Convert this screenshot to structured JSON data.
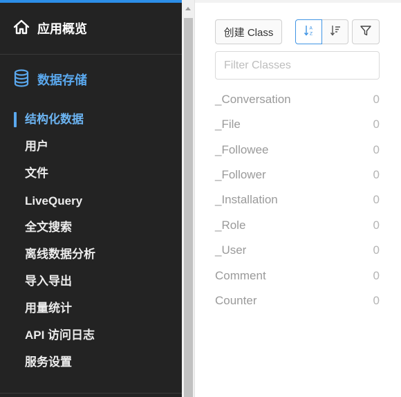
{
  "sidebar": {
    "overview_label": "应用概览",
    "storage_label": "数据存储",
    "items": [
      {
        "label": "结构化数据",
        "active": true
      },
      {
        "label": "用户"
      },
      {
        "label": "文件"
      },
      {
        "label": "LiveQuery"
      },
      {
        "label": "全文搜索"
      },
      {
        "label": "离线数据分析"
      },
      {
        "label": "导入导出"
      },
      {
        "label": "用量统计"
      },
      {
        "label": "API 访问日志"
      },
      {
        "label": "服务设置"
      }
    ],
    "accent_color": "#5aa8ee",
    "background_color": "#232323"
  },
  "toolbar": {
    "create_label": "创建 Class",
    "sort_alpha_icon": "sort-alpha-icon",
    "sort_desc_icon": "sort-desc-icon",
    "filter_icon": "filter-icon"
  },
  "search": {
    "placeholder": "Filter Classes",
    "value": ""
  },
  "classes": [
    {
      "name": "_Conversation",
      "count": "0"
    },
    {
      "name": "_File",
      "count": "0"
    },
    {
      "name": "_Followee",
      "count": "0"
    },
    {
      "name": "_Follower",
      "count": "0"
    },
    {
      "name": "_Installation",
      "count": "0"
    },
    {
      "name": "_Role",
      "count": "0"
    },
    {
      "name": "_User",
      "count": "0"
    },
    {
      "name": "Comment",
      "count": "0"
    },
    {
      "name": "Counter",
      "count": "0"
    }
  ]
}
